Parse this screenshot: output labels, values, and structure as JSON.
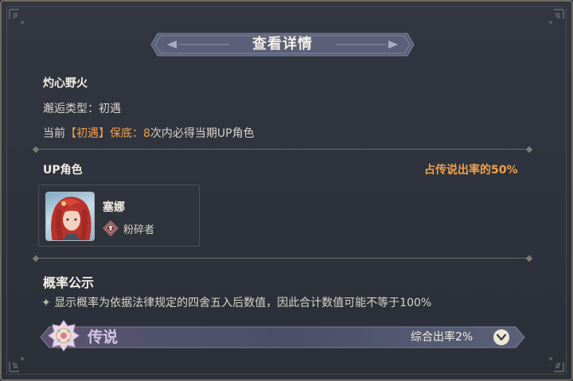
{
  "dialog": {
    "title": "查看详情"
  },
  "banner": {
    "name": "灼心野火",
    "encounter_label": "邂逅类型：",
    "encounter_type": "初遇",
    "guarantee_prefix": "当前",
    "guarantee_tag": "【初遇】保底：",
    "guarantee_count": "8",
    "guarantee_suffix": "次内必得当期UP角色"
  },
  "up_section": {
    "label": "UP角色",
    "rate_text": "占传说出率的50%",
    "character": {
      "name": "塞娜",
      "role": "粉碎者",
      "role_icon": "crusher-class-icon",
      "portrait": "red-haired-character-portrait"
    }
  },
  "probability": {
    "title": "概率公示",
    "notice_icon": "sparkle-icon",
    "notice": "显示概率为依据法律规定的四舍五入后数值，因此合计数值可能不等于100%",
    "tiers": [
      {
        "name": "传说",
        "rate_text": "综合出率2%",
        "emblem": "legendary-flower-emblem-icon",
        "expand_icon": "chevron-down-icon"
      }
    ]
  },
  "colors": {
    "accent_orange": "#f0a04b",
    "panel_bg": "#2e323c",
    "legend_purple": "#d6c6e8"
  }
}
